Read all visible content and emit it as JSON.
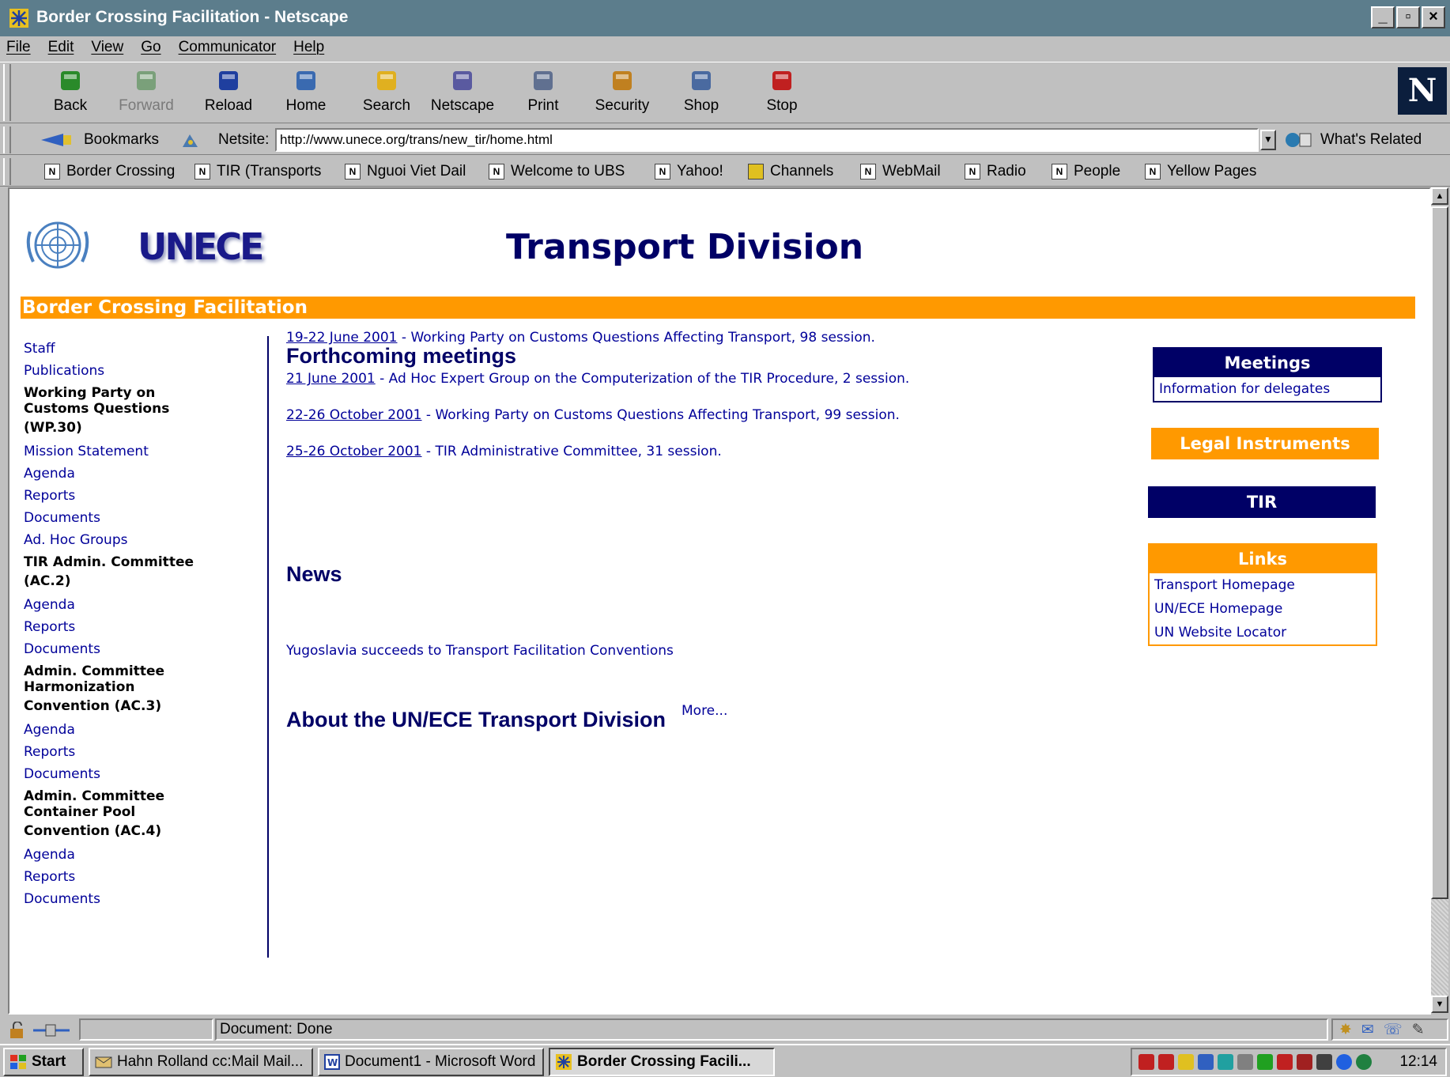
{
  "window": {
    "title": "Border Crossing Facilitation - Netscape",
    "controls": [
      "_",
      "▫",
      "×"
    ]
  },
  "menu": [
    "File",
    "Edit",
    "View",
    "Go",
    "Communicator",
    "Help"
  ],
  "nav_buttons": [
    {
      "label": "Back",
      "icon": "back-arrow-icon",
      "color": "#2a8a2a"
    },
    {
      "label": "Forward",
      "icon": "forward-arrow-icon",
      "color": "#7aa07a"
    },
    {
      "label": "Reload",
      "icon": "reload-icon",
      "color": "#1f3f9f"
    },
    {
      "label": "Home",
      "icon": "home-icon",
      "color": "#3a6ab0"
    },
    {
      "label": "Search",
      "icon": "search-icon",
      "color": "#e0b020"
    },
    {
      "label": "Netscape",
      "icon": "netscape-icon",
      "color": "#5a5aa0"
    },
    {
      "label": "Print",
      "icon": "print-icon",
      "color": "#607090"
    },
    {
      "label": "Security",
      "icon": "lock-icon",
      "color": "#c08020"
    },
    {
      "label": "Shop",
      "icon": "shop-icon",
      "color": "#4a6aa0"
    },
    {
      "label": "Stop",
      "icon": "stop-icon",
      "color": "#c02020"
    }
  ],
  "location": {
    "bookmarks_label": "Bookmarks",
    "netsite_label": "Netsite:",
    "url": "http://www.unece.org/trans/new_tir/home.html",
    "related_label": "What's Related"
  },
  "personal_toolbar": [
    "Border Crossing",
    "TIR (Transports",
    "Nguoi Viet Dail",
    "Welcome to UBS",
    "Yahoo!",
    "Channels",
    "WebMail",
    "Radio",
    "People",
    "Yellow Pages"
  ],
  "page": {
    "logo_text": "UNECE",
    "title": "Transport Division",
    "banner": "Border Crossing Facilitation",
    "left_nav": [
      {
        "type": "link",
        "text": "Staff"
      },
      {
        "type": "link",
        "text": "Publications"
      },
      {
        "type": "heading",
        "line1": "Working Party on",
        "line2": "Customs Questions",
        "line3": "(WP.30)"
      },
      {
        "type": "link",
        "text": "Mission Statement"
      },
      {
        "type": "link",
        "text": "Agenda"
      },
      {
        "type": "link",
        "text": "Reports"
      },
      {
        "type": "link",
        "text": "Documents"
      },
      {
        "type": "link",
        "text": "Ad. Hoc Groups"
      },
      {
        "type": "heading",
        "line1": "TIR Admin. Committee",
        "line2": "",
        "line3": "(AC.2)"
      },
      {
        "type": "link",
        "text": "Agenda"
      },
      {
        "type": "link",
        "text": "Reports"
      },
      {
        "type": "link",
        "text": "Documents"
      },
      {
        "type": "heading",
        "line1": "Admin. Committee",
        "line2": "Harmonization",
        "line3": "Convention (AC.3)"
      },
      {
        "type": "link",
        "text": "Agenda"
      },
      {
        "type": "link",
        "text": "Reports"
      },
      {
        "type": "link",
        "text": "Documents"
      },
      {
        "type": "heading",
        "line1": "Admin. Committee",
        "line2": "Container Pool",
        "line3": "Convention (AC.4)"
      },
      {
        "type": "link",
        "text": "Agenda"
      },
      {
        "type": "link",
        "text": "Reports"
      },
      {
        "type": "link",
        "text": "Documents"
      }
    ],
    "forthcoming_title": "Forthcoming meetings",
    "meetings": [
      {
        "date": "19-22 June 2001",
        "text": " - Working Party on Customs Questions Affecting Transport, 98 session."
      },
      {
        "date": "21 June 2001",
        "text": " - Ad Hoc Expert Group on the Computerization of the TIR Procedure, 2 session."
      },
      {
        "date": "22-26 October 2001",
        "text": " - Working Party on Customs Questions Affecting Transport, 99 session."
      },
      {
        "date": "25-26 October 2001",
        "text": " - TIR Administrative Committee, 31 session."
      }
    ],
    "news_title": "News",
    "news_item": "Yugoslavia succeeds to Transport Facilitation Conventions",
    "more_label": "More...",
    "about_title": "About the UN/ECE Transport Division",
    "sidebar": {
      "meetings_header": "Meetings",
      "meetings_item": "Information for delegates",
      "legal": "Legal Instruments",
      "tir": "TIR",
      "links_header": "Links",
      "links": [
        "Transport Homepage",
        "UN/ECE Homepage",
        "UN Website Locator"
      ]
    }
  },
  "status": {
    "text": "Document: Done"
  },
  "taskbar": {
    "start": "Start",
    "tasks": [
      "Hahn Rolland cc:Mail Mail...",
      "Document1 - Microsoft Word",
      "Border Crossing Facili..."
    ],
    "clock": "12:14"
  },
  "colors": {
    "orange": "#ff9900",
    "navy": "#000066",
    "link": "#000099"
  }
}
